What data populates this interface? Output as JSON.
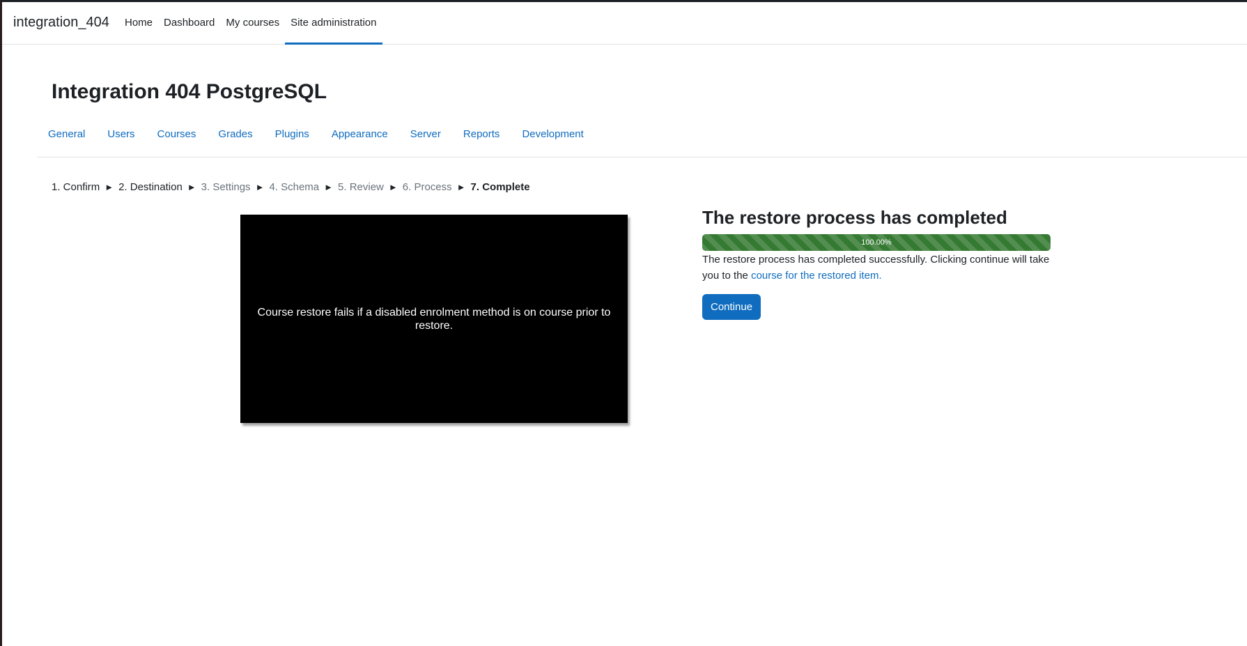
{
  "navbar": {
    "brand": "integration_404",
    "links": [
      {
        "label": "Home",
        "active": false
      },
      {
        "label": "Dashboard",
        "active": false
      },
      {
        "label": "My courses",
        "active": false
      },
      {
        "label": "Site administration",
        "active": true
      }
    ]
  },
  "page": {
    "title": "Integration 404 PostgreSQL"
  },
  "secondary_nav": {
    "tabs": [
      "General",
      "Users",
      "Courses",
      "Grades",
      "Plugins",
      "Appearance",
      "Server",
      "Reports",
      "Development"
    ]
  },
  "stepper": {
    "separator": "►",
    "steps": [
      {
        "label": "1. Confirm",
        "state": "done"
      },
      {
        "label": "2. Destination",
        "state": "done"
      },
      {
        "label": "3. Settings",
        "state": "pending"
      },
      {
        "label": "4. Schema",
        "state": "pending"
      },
      {
        "label": "5. Review",
        "state": "pending"
      },
      {
        "label": "6. Process",
        "state": "pending"
      },
      {
        "label": "7. Complete",
        "state": "current"
      }
    ]
  },
  "video": {
    "caption": "Course restore fails if a disabled enrolment method is on course prior to restore."
  },
  "result": {
    "heading": "The restore process has completed",
    "progress_label": "100.00%",
    "progress_fraction": 1.0,
    "message": "The restore process has completed successfully. Clicking continue will take you to the ",
    "link_text": "course for the restored item.",
    "continue_label": "Continue"
  },
  "colors": {
    "accent": "#0f6cbf",
    "success": "#357a32",
    "text": "#1d2125",
    "muted": "#6a737b"
  }
}
